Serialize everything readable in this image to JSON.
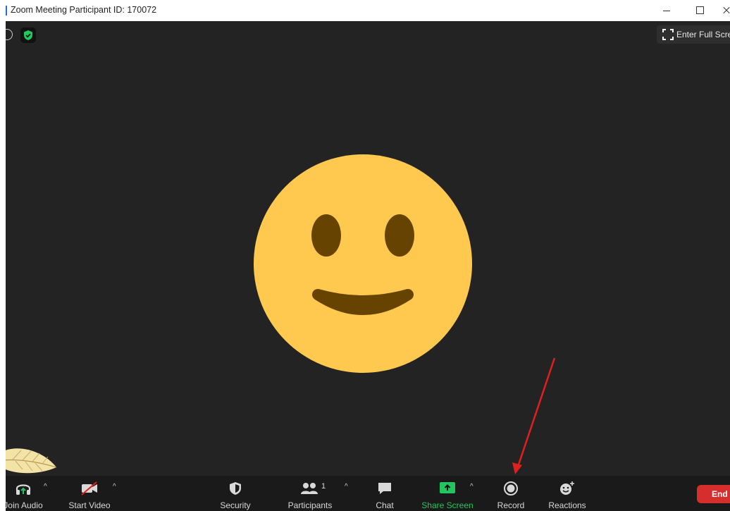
{
  "window": {
    "title": "Zoom Meeting Participant ID: 170072"
  },
  "meeting": {
    "fullscreen_label": "Enter Full Screen",
    "security_badge_color": "#22c55e",
    "avatar": "smiley-face",
    "avatar_color": "#ffc94f",
    "annotation_color": "#e01f1f"
  },
  "toolbar": {
    "join_audio": "Join Audio",
    "start_video": "Start Video",
    "security": "Security",
    "participants": "Participants",
    "participants_count": "1",
    "chat": "Chat",
    "share_screen": "Share Screen",
    "record": "Record",
    "reactions": "Reactions",
    "end": "End",
    "share_color": "#22c55e",
    "end_color": "#d62d2d",
    "caret": "^"
  }
}
